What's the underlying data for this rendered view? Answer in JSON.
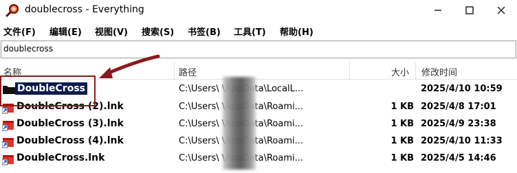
{
  "window": {
    "title": "doublecross - Everything"
  },
  "menu": [
    {
      "label": "文件(F)"
    },
    {
      "label": "编辑(E)"
    },
    {
      "label": "视图(V)"
    },
    {
      "label": "搜索(S)"
    },
    {
      "label": "书签(B)"
    },
    {
      "label": "工具(T)"
    },
    {
      "label": "帮助(H)"
    }
  ],
  "search": {
    "value": "doublecross"
  },
  "columns": {
    "name": "名称",
    "path": "路径",
    "size": "大小",
    "modified": "修改时间"
  },
  "rows": [
    {
      "name": "DoubleCross",
      "type": "folder",
      "path": "C:\\Users\\         \\AppData\\LocalL...",
      "size": "",
      "modified": "2025/4/10 10:59",
      "selected": true
    },
    {
      "name": "DoubleCross (2).lnk",
      "type": "lnk",
      "path": "C:\\Users\\         \\AppData\\Roami...",
      "size": "1 KB",
      "modified": "2025/4/8 17:01"
    },
    {
      "name": "DoubleCross (3).lnk",
      "type": "lnk",
      "path": "C:\\Users\\         \\AppData\\Roami...",
      "size": "1 KB",
      "modified": "2025/4/9 23:38"
    },
    {
      "name": "DoubleCross (4).lnk",
      "type": "lnk",
      "path": "C:\\Users\\         \\AppData\\Roami...",
      "size": "1 KB",
      "modified": "2025/4/10 11:33"
    },
    {
      "name": "DoubleCross.lnk",
      "type": "lnk",
      "path": "C:\\Users\\         \\AppData\\Roami...",
      "size": "1 KB",
      "modified": "2025/4/5 14:46"
    }
  ],
  "colors": {
    "selection": "#0b1a4a",
    "annotation": "#8b1a1a"
  }
}
